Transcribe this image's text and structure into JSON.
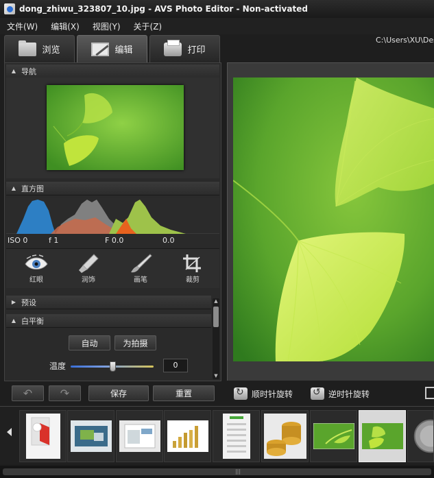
{
  "window": {
    "title": "dong_zhiwu_323807_10.jpg  -  AVS Photo Editor - Non-activated"
  },
  "menu": [
    {
      "label": "文件(W)"
    },
    {
      "label": "编辑(X)"
    },
    {
      "label": "视图(Y)"
    },
    {
      "label": "关于(Z)"
    }
  ],
  "tabs": [
    {
      "label": "浏览",
      "icon": "folder-icon"
    },
    {
      "label": "编辑",
      "icon": "edit-icon",
      "active": true
    },
    {
      "label": "打印",
      "icon": "printer-icon"
    }
  ],
  "path": "C:\\Users\\XU\\Desk",
  "panels": {
    "navigation": {
      "title": "导航"
    },
    "histogram": {
      "title": "直方图",
      "iso": "ISO 0",
      "f1": "f 1",
      "f2": "F 0.0",
      "ev": "0.0"
    },
    "tools": [
      {
        "label": "红眼",
        "icon": "eye-icon"
      },
      {
        "label": "润饰",
        "icon": "retouch-brush-icon"
      },
      {
        "label": "画笔",
        "icon": "paint-brush-icon"
      },
      {
        "label": "裁剪",
        "icon": "crop-icon"
      }
    ],
    "presets": {
      "title": "预设"
    },
    "white_balance": {
      "title": "白平衡",
      "auto_label": "自动",
      "as_shot_label": "为拍摄",
      "temperature_label": "温度",
      "temperature_value": "0"
    }
  },
  "actions": {
    "save_label": "保存",
    "reset_label": "重置"
  },
  "main_toolbar": {
    "rotate_cw_label": "顺时针旋转",
    "rotate_ccw_label": "逆时针旋转"
  },
  "colors": {
    "accent": "#2b6fd6",
    "leaf_green": "#9fd62e",
    "bg_dark": "#1e1e1e"
  }
}
